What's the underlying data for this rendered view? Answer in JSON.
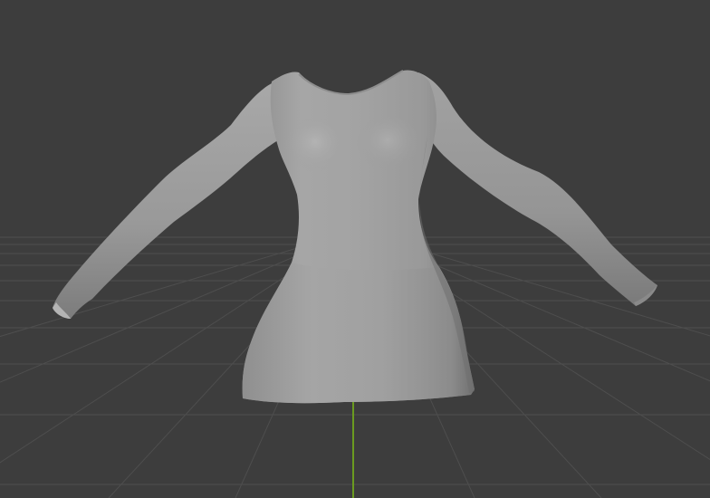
{
  "viewport": {
    "background_color": "#3d3d3d",
    "grid_line_color": "#4e4e4e",
    "y_axis_color": "#6b9b20",
    "mesh_color": "#9c9c9c",
    "mesh_highlight_color": "#b8b8b8",
    "mesh_shadow_color": "#6a6a6a"
  },
  "scene": {
    "object": "dress-mesh",
    "shading": "solid"
  }
}
